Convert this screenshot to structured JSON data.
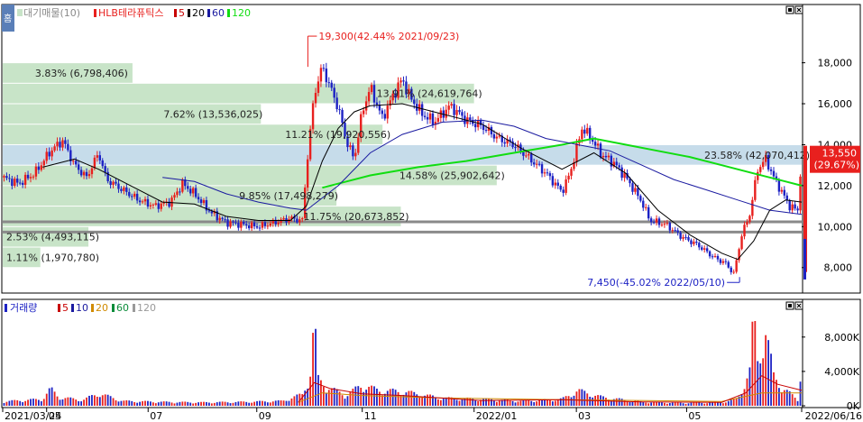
{
  "toolbar": {
    "home_label": "홈",
    "max_button": "□",
    "close_button": "×"
  },
  "colors": {
    "up": "#e8201e",
    "down": "#1d22c4",
    "ma5": "#c80000",
    "ma20": "#000000",
    "ma60": "#1a1aa0",
    "ma120": "#11dd11",
    "volume_profile": "#c8e4c8",
    "volume_profile_peak": "#c6dcea",
    "frame": "#000000",
    "grid": "#c8c8c8"
  },
  "chart_data": [
    {
      "type": "candlestick",
      "title": "HLB테라퓨틱스",
      "legend": {
        "profile_label": "대기매물(10)",
        "ma_prefix": "",
        "items": [
          {
            "label": "HLB테라퓨틱스",
            "color": "#e8201e"
          },
          {
            "label": "5",
            "color": "#c80000"
          },
          {
            "label": "20",
            "color": "#000000"
          },
          {
            "label": "60",
            "color": "#1a1aa0"
          },
          {
            "label": "120",
            "color": "#11dd11"
          }
        ]
      },
      "y_ticks": [
        "18,000",
        "16,000",
        "14,000",
        "12,000",
        "10,000",
        "8,000"
      ],
      "y_tick_values": [
        18000,
        16000,
        14000,
        12000,
        10000,
        8000
      ],
      "ylim": [
        6800,
        20800
      ],
      "x_ticks": [
        "2021/03/24",
        "05",
        "07",
        "09",
        "11",
        "2022/01",
        "03",
        "05",
        "2022/06/16"
      ],
      "x_tick_positions": [
        0,
        0.055,
        0.182,
        0.318,
        0.45,
        0.59,
        0.718,
        0.856,
        1.0
      ],
      "last_price": {
        "value": "13,550",
        "change": "(29.67%)",
        "price": 13550
      },
      "high_annotation": {
        "text": "19,300(42.44% 2021/09/23)",
        "price": 19300,
        "t": 0.4
      },
      "low_annotation": {
        "text": "7,450(-45.02% 2022/05/10)",
        "price": 7450,
        "t": 0.92
      },
      "volume_profile": [
        {
          "label": "3.83% (6,798,406)",
          "percent": 3.83,
          "volume": 6798406,
          "low": 17000,
          "high": 18000
        },
        {
          "label": "13.91% (24,619,764)",
          "percent": 13.91,
          "volume": 24619764,
          "low": 16000,
          "high": 17000
        },
        {
          "label": "7.62% (13,536,025)",
          "percent": 7.62,
          "volume": 13536025,
          "low": 15000,
          "high": 16000
        },
        {
          "label": "11.21% (19,920,556)",
          "percent": 11.21,
          "volume": 19920556,
          "low": 14000,
          "high": 15000
        },
        {
          "label": "23.58% (42,070,412)",
          "percent": 23.58,
          "volume": 42070412,
          "low": 13000,
          "high": 14000
        },
        {
          "label": "14.58% (25,902,642)",
          "percent": 14.58,
          "volume": 25902642,
          "low": 12000,
          "high": 13000
        },
        {
          "label": "9.85% (17,498,279)",
          "percent": 9.85,
          "volume": 17498279,
          "low": 11000,
          "high": 12000
        },
        {
          "label": "11.75% (20,673,852)",
          "percent": 11.75,
          "volume": 20673852,
          "low": 10000,
          "high": 11000
        },
        {
          "label": "2.53% (4,493,115)",
          "percent": 2.53,
          "volume": 4493115,
          "low": 9000,
          "high": 10000
        },
        {
          "label": "1.11% (1,970,780)",
          "percent": 1.11,
          "volume": 1970780,
          "low": 8000,
          "high": 9000
        }
      ],
      "price_path": [
        [
          0.0,
          12400
        ],
        [
          0.02,
          12100
        ],
        [
          0.04,
          12600
        ],
        [
          0.06,
          13700
        ],
        [
          0.075,
          14200
        ],
        [
          0.09,
          13000
        ],
        [
          0.105,
          12400
        ],
        [
          0.12,
          13600
        ],
        [
          0.13,
          12300
        ],
        [
          0.15,
          11800
        ],
        [
          0.17,
          11300
        ],
        [
          0.19,
          11000
        ],
        [
          0.21,
          11200
        ],
        [
          0.225,
          12100
        ],
        [
          0.24,
          11600
        ],
        [
          0.26,
          10700
        ],
        [
          0.28,
          10200
        ],
        [
          0.3,
          10100
        ],
        [
          0.32,
          10000
        ],
        [
          0.34,
          10200
        ],
        [
          0.36,
          10400
        ],
        [
          0.375,
          10300
        ],
        [
          0.38,
          12800
        ],
        [
          0.39,
          16500
        ],
        [
          0.4,
          17800
        ],
        [
          0.41,
          16800
        ],
        [
          0.42,
          15800
        ],
        [
          0.43,
          14200
        ],
        [
          0.44,
          13300
        ],
        [
          0.45,
          15600
        ],
        [
          0.46,
          16800
        ],
        [
          0.475,
          15300
        ],
        [
          0.49,
          16500
        ],
        [
          0.5,
          17200
        ],
        [
          0.51,
          16300
        ],
        [
          0.525,
          15500
        ],
        [
          0.54,
          15100
        ],
        [
          0.56,
          15900
        ],
        [
          0.58,
          15200
        ],
        [
          0.6,
          14900
        ],
        [
          0.62,
          14300
        ],
        [
          0.64,
          14000
        ],
        [
          0.66,
          13300
        ],
        [
          0.68,
          12600
        ],
        [
          0.7,
          11700
        ],
        [
          0.71,
          12600
        ],
        [
          0.725,
          14800
        ],
        [
          0.735,
          14400
        ],
        [
          0.75,
          13500
        ],
        [
          0.765,
          13100
        ],
        [
          0.78,
          12400
        ],
        [
          0.8,
          11200
        ],
        [
          0.81,
          10300
        ],
        [
          0.83,
          10100
        ],
        [
          0.85,
          9500
        ],
        [
          0.87,
          9100
        ],
        [
          0.89,
          8500
        ],
        [
          0.905,
          8200
        ],
        [
          0.915,
          7700
        ],
        [
          0.925,
          9600
        ],
        [
          0.935,
          10600
        ],
        [
          0.945,
          12800
        ],
        [
          0.955,
          13300
        ],
        [
          0.965,
          12400
        ],
        [
          0.975,
          11700
        ],
        [
          0.985,
          11000
        ],
        [
          0.995,
          10800
        ],
        [
          1.0,
          13550
        ]
      ],
      "ma_paths": {
        "ma20": [
          [
            0.05,
            12900
          ],
          [
            0.09,
            13300
          ],
          [
            0.12,
            12800
          ],
          [
            0.16,
            12000
          ],
          [
            0.2,
            11200
          ],
          [
            0.24,
            11100
          ],
          [
            0.28,
            10500
          ],
          [
            0.32,
            10300
          ],
          [
            0.36,
            10300
          ],
          [
            0.38,
            11000
          ],
          [
            0.4,
            13200
          ],
          [
            0.42,
            14800
          ],
          [
            0.44,
            15600
          ],
          [
            0.46,
            15900
          ],
          [
            0.5,
            16000
          ],
          [
            0.55,
            15500
          ],
          [
            0.6,
            15000
          ],
          [
            0.65,
            13800
          ],
          [
            0.7,
            12800
          ],
          [
            0.74,
            13600
          ],
          [
            0.78,
            12600
          ],
          [
            0.82,
            10800
          ],
          [
            0.86,
            9600
          ],
          [
            0.9,
            8700
          ],
          [
            0.92,
            8400
          ],
          [
            0.94,
            9300
          ],
          [
            0.96,
            10800
          ],
          [
            0.98,
            11300
          ],
          [
            1.0,
            11200
          ]
        ],
        "ma60": [
          [
            0.2,
            12400
          ],
          [
            0.24,
            12200
          ],
          [
            0.28,
            11600
          ],
          [
            0.32,
            11200
          ],
          [
            0.36,
            10900
          ],
          [
            0.38,
            10800
          ],
          [
            0.42,
            12000
          ],
          [
            0.46,
            13600
          ],
          [
            0.5,
            14500
          ],
          [
            0.55,
            15100
          ],
          [
            0.6,
            15200
          ],
          [
            0.64,
            14900
          ],
          [
            0.68,
            14300
          ],
          [
            0.72,
            14000
          ],
          [
            0.76,
            13700
          ],
          [
            0.8,
            13000
          ],
          [
            0.84,
            12300
          ],
          [
            0.88,
            11800
          ],
          [
            0.92,
            11300
          ],
          [
            0.96,
            10800
          ],
          [
            1.0,
            10600
          ]
        ],
        "ma120": [
          [
            0.4,
            11900
          ],
          [
            0.46,
            12500
          ],
          [
            0.52,
            12900
          ],
          [
            0.58,
            13200
          ],
          [
            0.64,
            13600
          ],
          [
            0.7,
            14000
          ],
          [
            0.74,
            14300
          ],
          [
            0.78,
            14000
          ],
          [
            0.82,
            13700
          ],
          [
            0.86,
            13400
          ],
          [
            0.9,
            13000
          ],
          [
            0.94,
            12600
          ],
          [
            0.98,
            12200
          ],
          [
            1.0,
            12000
          ]
        ]
      }
    },
    {
      "type": "bar",
      "title": "거래량",
      "legend": {
        "items": [
          {
            "label": "거래량",
            "color": "#1d22c4"
          },
          {
            "label": "5",
            "color": "#c80000"
          },
          {
            "label": "10",
            "color": "#1a1aa0"
          },
          {
            "label": "20",
            "color": "#d08a00"
          },
          {
            "label": "60",
            "color": "#0b8c3a"
          },
          {
            "label": "120",
            "color": "#9a9a9a"
          }
        ]
      },
      "y_ticks": [
        "8,000K",
        "4,000K",
        "0K"
      ],
      "y_tick_values": [
        8000,
        4000,
        0
      ],
      "ylim": [
        0,
        10500
      ],
      "volume_path": [
        [
          0.0,
          450
        ],
        [
          0.05,
          700
        ],
        [
          0.06,
          1800
        ],
        [
          0.07,
          900
        ],
        [
          0.1,
          600
        ],
        [
          0.12,
          1300
        ],
        [
          0.15,
          500
        ],
        [
          0.2,
          400
        ],
        [
          0.25,
          350
        ],
        [
          0.3,
          400
        ],
        [
          0.35,
          500
        ],
        [
          0.375,
          1200
        ],
        [
          0.385,
          3400
        ],
        [
          0.39,
          9000
        ],
        [
          0.395,
          2800
        ],
        [
          0.41,
          1800
        ],
        [
          0.43,
          1100
        ],
        [
          0.45,
          2200
        ],
        [
          0.47,
          1600
        ],
        [
          0.5,
          1500
        ],
        [
          0.55,
          800
        ],
        [
          0.6,
          700
        ],
        [
          0.65,
          500
        ],
        [
          0.7,
          700
        ],
        [
          0.72,
          1600
        ],
        [
          0.75,
          900
        ],
        [
          0.8,
          400
        ],
        [
          0.85,
          300
        ],
        [
          0.9,
          350
        ],
        [
          0.92,
          700
        ],
        [
          0.935,
          3600
        ],
        [
          0.94,
          9500
        ],
        [
          0.945,
          4800
        ],
        [
          0.955,
          7800
        ],
        [
          0.965,
          3100
        ],
        [
          0.975,
          2000
        ],
        [
          0.985,
          1300
        ],
        [
          0.995,
          600
        ],
        [
          1.0,
          5300
        ]
      ],
      "ma_paths": {
        "ma5": [
          [
            0.37,
            400
          ],
          [
            0.39,
            2700
          ],
          [
            0.41,
            2000
          ],
          [
            0.45,
            1400
          ],
          [
            0.5,
            1200
          ],
          [
            0.6,
            600
          ],
          [
            0.7,
            700
          ],
          [
            0.8,
            450
          ],
          [
            0.9,
            400
          ],
          [
            0.93,
            1500
          ],
          [
            0.95,
            3500
          ],
          [
            0.97,
            2500
          ],
          [
            1.0,
            1800
          ]
        ],
        "ma20": [
          [
            0.37,
            400
          ],
          [
            0.4,
            1500
          ],
          [
            0.45,
            1200
          ],
          [
            0.55,
            900
          ],
          [
            0.7,
            700
          ],
          [
            0.9,
            500
          ],
          [
            0.95,
            1500
          ],
          [
            1.0,
            1500
          ]
        ]
      }
    }
  ]
}
